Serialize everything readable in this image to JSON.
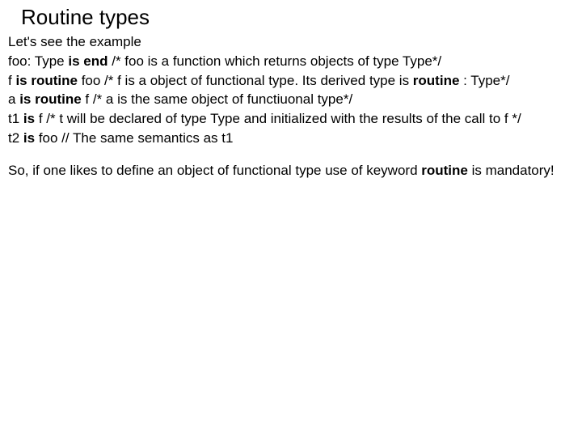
{
  "title": "Routine types",
  "lines": {
    "l0": "Let's see the example",
    "l1a": "foo: Type ",
    "l1b": "is end ",
    "l1c": "/* foo is a function which returns objects of type Type*/",
    "l2a": "f ",
    "l2b": "is routine ",
    "l2c": "foo /* f is a object of functional type. Its derived type is ",
    "l2d": "routine ",
    "l2e": ": Type*/",
    "l3a": "a ",
    "l3b": "is routine ",
    "l3c": "f /* a is the same object of functiuonal type*/",
    "l4a": "t1 ",
    "l4b": "is ",
    "l4c": "f /* t will be declared of type Type and initialized with the results of the call to f */",
    "l5a": "t2 ",
    "l5b": "is ",
    "l5c": "foo // The same semantics as t1",
    "l6a": "So, if one likes to define an object of functional type use of keyword ",
    "l6b": "routine ",
    "l6c": "is mandatory!"
  }
}
